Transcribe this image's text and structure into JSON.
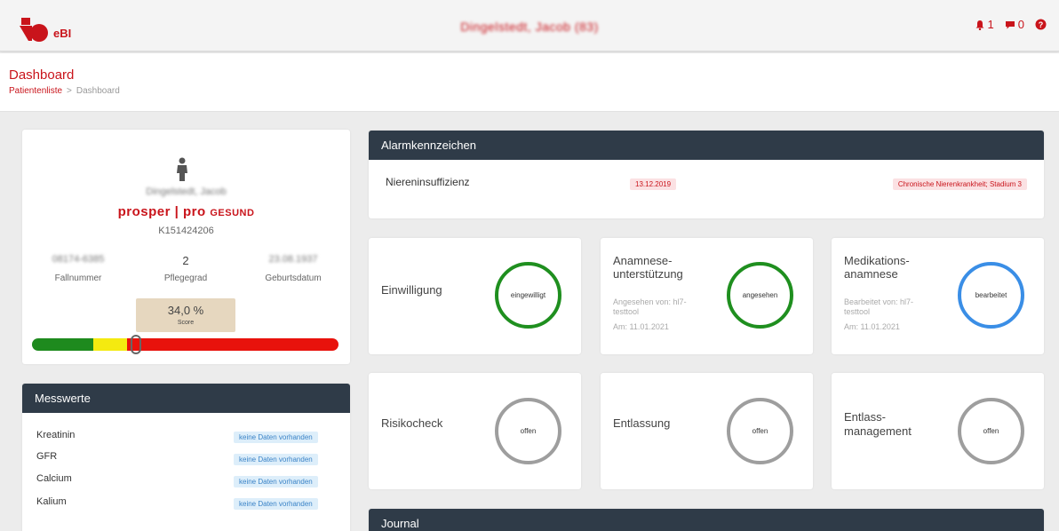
{
  "topbar": {
    "logo_text": "eBI",
    "patient_title": "Dingelstedt, Jacob (83)",
    "notifications_count": "1",
    "messages_count": "0",
    "help_glyph": "?"
  },
  "header": {
    "title": "Dashboard",
    "breadcrumb_link": "Patientenliste",
    "breadcrumb_separator": ">",
    "breadcrumb_current": "Dashboard"
  },
  "patient": {
    "name": "Dingelstedt, Jacob",
    "insurance_part1": "prosper",
    "insurance_sep": "|",
    "insurance_part2": "pro",
    "insurance_part3": "GESUND",
    "k_number": "K151424206",
    "fallnummer_value": "08174-6385",
    "fallnummer_label": "Fallnummer",
    "pflegegrad_value": "2",
    "pflegegrad_label": "Pflegegrad",
    "geburtsdatum_value": "23.08.1937",
    "geburtsdatum_label": "Geburtsdatum",
    "score_value": "34,0 %",
    "score_label": "Score",
    "score_fraction": 0.34
  },
  "messwerte": {
    "title": "Messwerte",
    "rows": [
      {
        "label": "Kreatinin",
        "value": "keine Daten vorhanden"
      },
      {
        "label": "GFR",
        "value": "keine Daten vorhanden"
      },
      {
        "label": "Calcium",
        "value": "keine Daten vorhanden"
      },
      {
        "label": "Kalium",
        "value": "keine Daten vorhanden"
      }
    ]
  },
  "alarm": {
    "title": "Alarmkennzeichen",
    "name": "Niereninsuffizienz",
    "date": "13.12.2019",
    "description": "Chronische Nierenkrankheit; Stadium 3"
  },
  "status_cards": {
    "einwilligung": {
      "title": "Einwilligung",
      "status": "eingewilligt"
    },
    "anamnese": {
      "title_line1": "Anamnese-",
      "title_line2": "unterstützung",
      "sub_line1": "Angesehen von: hl7-",
      "sub_line2": "testtool",
      "date": "Am: 11.01.2021",
      "status": "angesehen"
    },
    "medikation": {
      "title_line1": "Medikations-",
      "title_line2": "anamnese",
      "sub_line1": "Bearbeitet von: hl7-",
      "sub_line2": "testtool",
      "date": "Am: 11.01.2021",
      "status": "bearbeitet"
    },
    "risikocheck": {
      "title": "Risikocheck",
      "status": "offen"
    },
    "entlassung": {
      "title": "Entlassung",
      "status": "offen"
    },
    "entlassmanagement": {
      "title_line1": "Entlass-",
      "title_line2": "management",
      "status": "offen"
    }
  },
  "journal": {
    "title": "Journal"
  },
  "colors": {
    "brand": "#c9141b",
    "header_dark": "#2f3b48",
    "ok": "#1f8f1f",
    "info": "#3a8ee6",
    "neutral": "#9e9e9e"
  },
  "icons": [
    "ebi-logo-icon",
    "person-icon",
    "bell-icon",
    "message-icon",
    "help-icon"
  ]
}
